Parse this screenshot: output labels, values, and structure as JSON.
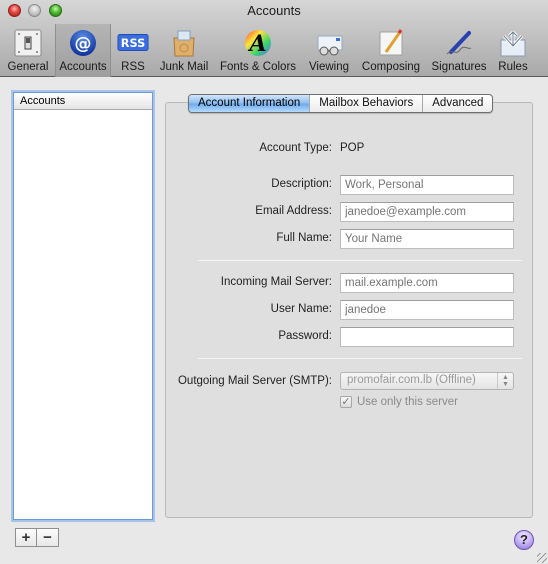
{
  "window": {
    "title": "Accounts"
  },
  "toolbar": {
    "items": [
      {
        "label": "General",
        "icon": "light-switch-icon",
        "selected": false
      },
      {
        "label": "Accounts",
        "icon": "at-sign-icon",
        "selected": true
      },
      {
        "label": "RSS",
        "icon": "rss-icon",
        "selected": false
      },
      {
        "label": "Junk Mail",
        "icon": "junk-mail-bag-icon",
        "selected": false
      },
      {
        "label": "Fonts & Colors",
        "icon": "fonts-colors-icon",
        "selected": false
      },
      {
        "label": "Viewing",
        "icon": "viewing-glasses-icon",
        "selected": false
      },
      {
        "label": "Composing",
        "icon": "composing-pencil-icon",
        "selected": false
      },
      {
        "label": "Signatures",
        "icon": "signature-pen-icon",
        "selected": false
      },
      {
        "label": "Rules",
        "icon": "rules-arrows-icon",
        "selected": false
      }
    ]
  },
  "sidebar": {
    "header": "Accounts",
    "add_label": "+",
    "remove_label": "−"
  },
  "tabs": [
    {
      "label": "Account Information",
      "active": true
    },
    {
      "label": "Mailbox Behaviors",
      "active": false
    },
    {
      "label": "Advanced",
      "active": false
    }
  ],
  "form": {
    "account_type": {
      "label": "Account Type:",
      "value": "POP"
    },
    "description": {
      "label": "Description:",
      "value": "",
      "placeholder": "Work, Personal"
    },
    "email": {
      "label": "Email Address:",
      "value": "",
      "placeholder": "janedoe@example.com"
    },
    "full_name": {
      "label": "Full Name:",
      "value": "",
      "placeholder": "Your Name"
    },
    "incoming_server": {
      "label": "Incoming Mail Server:",
      "value": "",
      "placeholder": "mail.example.com"
    },
    "user_name": {
      "label": "User Name:",
      "value": "",
      "placeholder": "janedoe"
    },
    "password": {
      "label": "Password:",
      "value": "",
      "placeholder": ""
    },
    "outgoing_server": {
      "label": "Outgoing Mail Server (SMTP):",
      "selected": "promofair.com.lb (Offline)"
    },
    "use_only_server": {
      "label": "Use only this server",
      "checked": true,
      "check_glyph": "✓"
    }
  },
  "help": {
    "label": "?"
  },
  "colors": {
    "accent": "#6aa9ea",
    "selection_border": "#6e9ad2",
    "help": "#c4b0f5"
  }
}
